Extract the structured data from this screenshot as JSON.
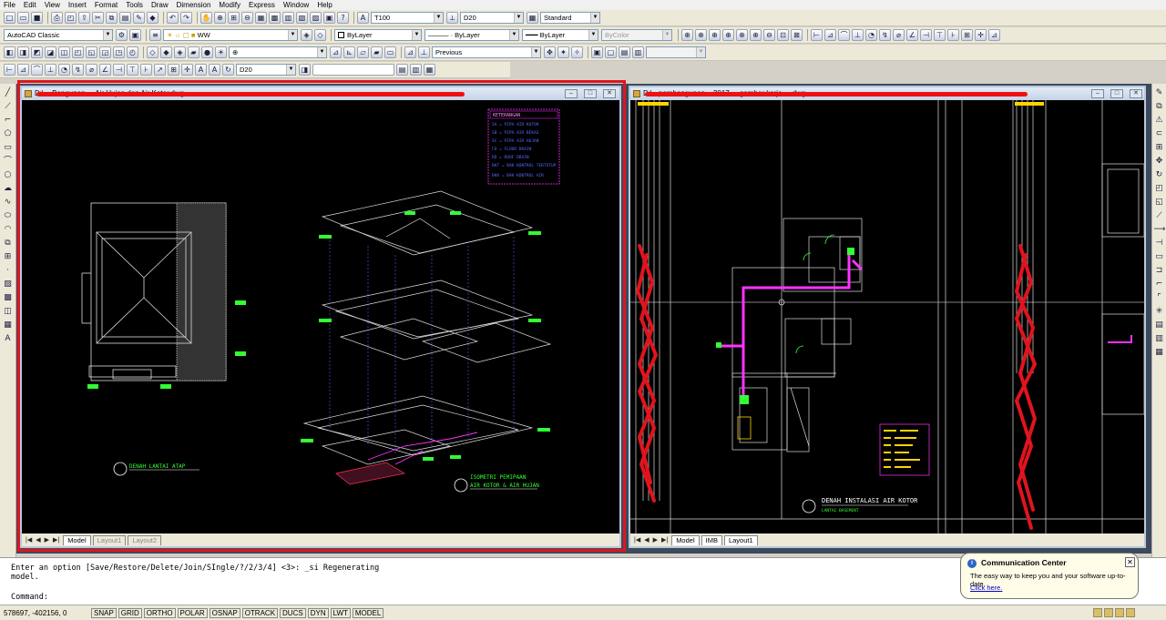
{
  "menu": [
    "File",
    "Edit",
    "View",
    "Insert",
    "Format",
    "Tools",
    "Draw",
    "Dimension",
    "Modify",
    "Express",
    "Window",
    "Help"
  ],
  "toolbar": {
    "textstyle": "T100",
    "dimstyle": "D20",
    "tablestyle": "Standard",
    "workspace": "AutoCAD Classic",
    "layer": "WW",
    "color": "ByLayer",
    "linetype": "ByLayer",
    "lineweight": "ByLayer",
    "plotstyle": "ByColor",
    "view_previous": "Previous",
    "dim_current": "D20"
  },
  "left_window": {
    "title": "D:\\... Bangunan ... Air Hujan dan Air Kotor.dwg",
    "tabs": [
      "Model",
      "Layout1",
      "Layout2"
    ],
    "legend_title": "KETERANGAN",
    "legend_rows": [
      "SA  = PIPA AIR KOTOR",
      "SB  = PIPA AIR BEKAS",
      "SC  = PIPA AIR HUJAN",
      "FD  = FLOOR DRAIN",
      "RD  = ROOF DRAIN",
      "BKT = BAK KONTROL TERTUTUP",
      "BKH = BAK KONTROL AIR"
    ],
    "plan_label": "DENAH LANTAI ATAP",
    "iso_label1": "ISOMETRI PEMIPAAN",
    "iso_label2": "AIR KOTOR & AIR HUJAN"
  },
  "right_window": {
    "title": "D:\\...pembangunan... 2017 ... gambar kerja ....dwg",
    "tabs": [
      "Model",
      "IMB",
      "Layout1"
    ],
    "plan_label": "DENAH INSTALASI AIR KOTOR",
    "plan_sub": "LANTAI BASEMENT"
  },
  "command": {
    "line1": "Enter an option [Save/Restore/Delete/Join/SIngle/?/2/3/4] <3>: _si Regenerating",
    "line2": "model.",
    "prompt": "Command:"
  },
  "status": {
    "coords": "578697, -402156, 0",
    "buttons": [
      "SNAP",
      "GRID",
      "ORTHO",
      "POLAR",
      "OSNAP",
      "OTRACK",
      "DUCS",
      "DYN",
      "LWT",
      "MODEL"
    ]
  },
  "comm_center": {
    "title": "Communication Center",
    "body": "The easy way to keep you and your software up-to-date.",
    "link": "Click here."
  },
  "colors": {
    "highlight": "#e0141e",
    "pipe": "#ff33ff",
    "drawing": "#ffffff",
    "tag": "#00ff00",
    "legend": "#5566ff"
  }
}
